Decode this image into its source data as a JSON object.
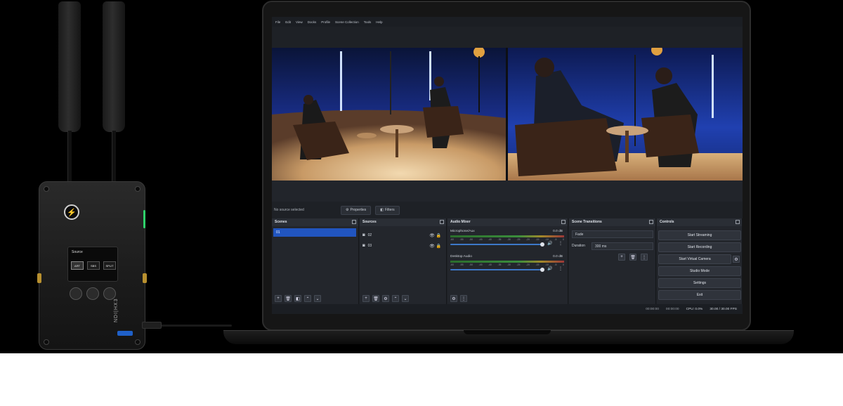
{
  "menu": [
    "File",
    "Edit",
    "View",
    "Docks",
    "Profile",
    "Scene Collection",
    "Tools",
    "Help"
  ],
  "props_bar": {
    "no_source": "No source selected",
    "properties": "Properties",
    "filters": "Filters"
  },
  "scenes": {
    "title": "Scenes",
    "items": [
      "01"
    ]
  },
  "sources": {
    "title": "Sources",
    "items": [
      "02",
      "03"
    ]
  },
  "audio_mixer": {
    "title": "Audio Mixer",
    "channels": [
      {
        "name": "Microphone/Aux",
        "db": "0.0 dB"
      },
      {
        "name": "Desktop Audio",
        "db": "0.0 dB"
      }
    ],
    "ticks": [
      "-60",
      "-55",
      "-50",
      "-45",
      "-40",
      "-35",
      "-30",
      "-25",
      "-20",
      "-15",
      "-10",
      "-5",
      "0"
    ]
  },
  "transitions": {
    "title": "Scene Transitions",
    "type": "Fade",
    "duration_label": "Duration",
    "duration": "300 ms"
  },
  "controls": {
    "title": "Controls",
    "buttons": [
      "Start Streaming",
      "Start Recording",
      "Start Virtual Camera",
      "Studio Mode",
      "Settings",
      "Exit"
    ]
  },
  "status": {
    "rec_time": "00:00:00",
    "stream_time": "00:00:00",
    "cpu": "CPU: 0.0%",
    "fps": "30.00 / 30.00 FPS"
  },
  "device": {
    "screen_title": "Source",
    "modes": [
      "ART",
      "SBS",
      "SPLIT"
    ],
    "brand": "NDI|HX3"
  },
  "colors": {
    "accent": "#2155c0",
    "panel": "#23262c",
    "background": "#1e2126"
  }
}
